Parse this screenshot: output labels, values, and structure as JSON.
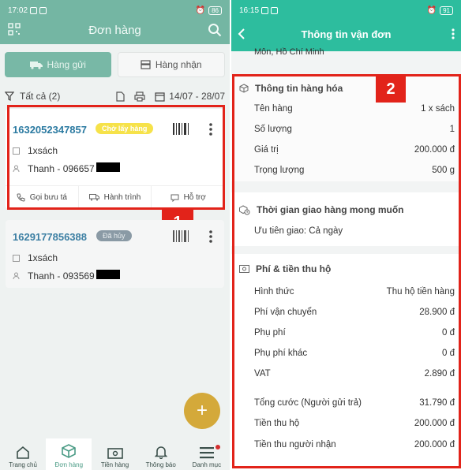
{
  "left": {
    "status": {
      "time": "17:02",
      "battery": "86"
    },
    "header": {
      "title": "Đơn hàng"
    },
    "tabs": [
      {
        "label": "Hàng gửi"
      },
      {
        "label": "Hàng nhận"
      }
    ],
    "filter": {
      "label": "Tất cả (2)",
      "date_range": "14/07 - 28/07"
    },
    "orders": [
      {
        "code": "1632052347857",
        "status": "Chờ lấy hàng",
        "item": "1xsách",
        "recipient": "Thanh - 096657"
      },
      {
        "code": "1629177856388",
        "status": "Đã hủy",
        "item": "1xsách",
        "recipient": "Thanh - 093569"
      }
    ],
    "card_actions": [
      {
        "label": "Gọi bưu tá"
      },
      {
        "label": "Hành trình"
      },
      {
        "label": "Hỗ trợ"
      }
    ],
    "callout": "1",
    "fab": "+",
    "nav": [
      {
        "label": "Trang chủ"
      },
      {
        "label": "Đơn hàng"
      },
      {
        "label": "Tiền hàng"
      },
      {
        "label": "Thông báo"
      },
      {
        "label": "Danh mục"
      }
    ]
  },
  "right": {
    "status": {
      "time": "16:15",
      "battery": "91"
    },
    "header": {
      "title": "Thông tin vận đơn"
    },
    "address_partial": "Môn, Hồ Chí Minh",
    "callout": "2",
    "goods": {
      "title": "Thông tin hàng hóa",
      "rows": [
        {
          "label": "Tên hàng",
          "value": "1 x sách"
        },
        {
          "label": "Số lượng",
          "value": "1"
        },
        {
          "label": "Giá trị",
          "value": "200.000 đ"
        },
        {
          "label": "Trọng lượng",
          "value": "500 g"
        }
      ]
    },
    "delivery": {
      "title": "Thời gian giao hàng mong muốn",
      "priority": "Ưu tiên giao: Cả ngày"
    },
    "fees": {
      "title": "Phí & tiền thu hộ",
      "rows": [
        {
          "label": "Hình thức",
          "value": "Thu hộ tiền hàng"
        },
        {
          "label": "Phí vận chuyển",
          "value": "28.900 đ"
        },
        {
          "label": "Phụ phí",
          "value": "0 đ"
        },
        {
          "label": "Phụ phí khác",
          "value": "0 đ"
        },
        {
          "label": "VAT",
          "value": "2.890 đ"
        },
        {
          "label": "Tổng cước (Người gửi trả)",
          "value": "31.790 đ"
        },
        {
          "label": "Tiền thu hộ",
          "value": "200.000 đ"
        },
        {
          "label": "Tiền thu người nhận",
          "value": "200.000 đ"
        }
      ]
    }
  },
  "colors": {
    "left_header": "#74b6a3",
    "right_header": "#2dbd9e",
    "highlight": "#e2231a",
    "order_code": "#2b7aa1",
    "badge_wait": "#f6e24a",
    "badge_cancel": "#8a9aa5",
    "fab": "#d4a93a"
  }
}
